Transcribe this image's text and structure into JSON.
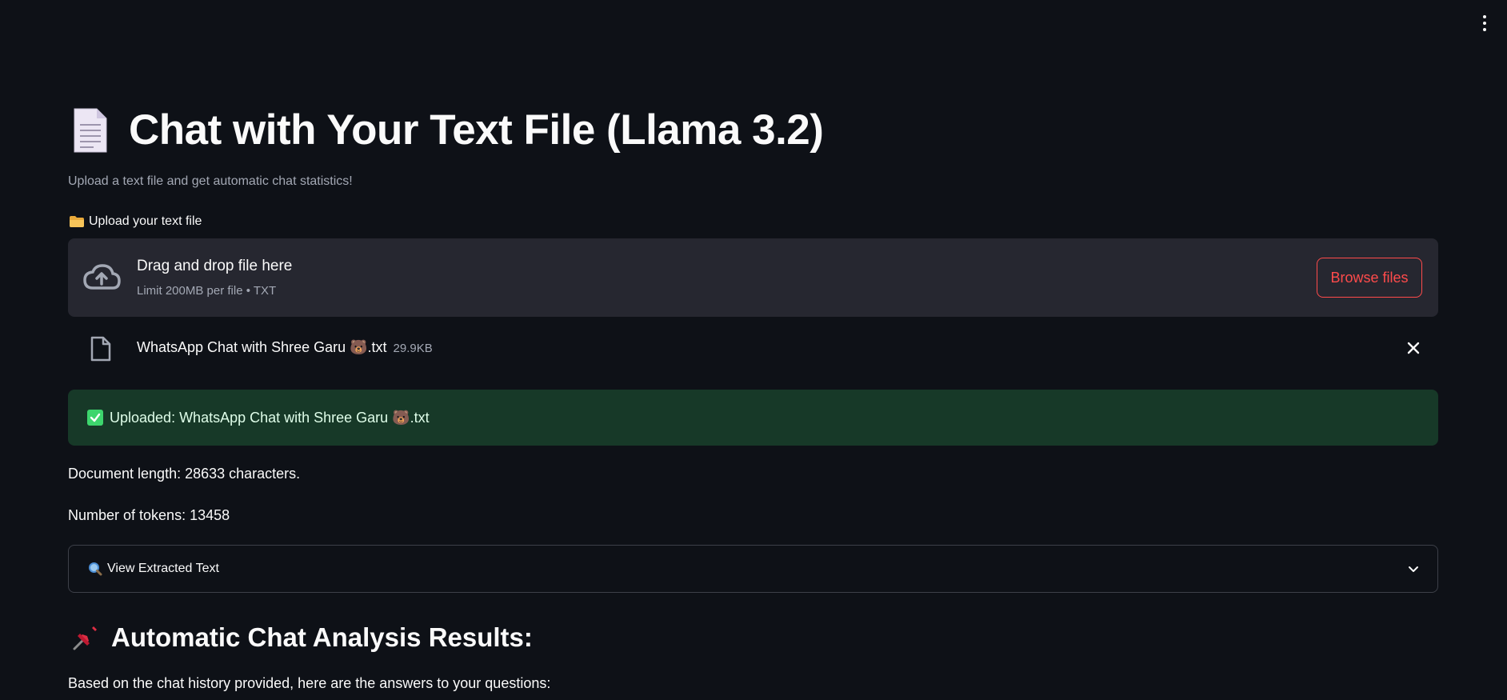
{
  "page": {
    "title": "Chat with Your Text File (Llama 3.2)",
    "subtitle": "Upload a text file and get automatic chat statistics!"
  },
  "uploader": {
    "label": "Upload your text file",
    "dropzone_title": "Drag and drop file here",
    "dropzone_limit": "Limit 200MB per file • TXT",
    "browse_label": "Browse files"
  },
  "uploaded_file": {
    "name": "WhatsApp Chat with Shree Garu 🐻.txt",
    "size": "29.9KB"
  },
  "status": {
    "success_message": "Uploaded: WhatsApp Chat with Shree Garu 🐻.txt"
  },
  "stats": {
    "document_length": "Document length: 28633 characters.",
    "token_count": "Number of tokens: 13458"
  },
  "expander": {
    "label": "View Extracted Text"
  },
  "results": {
    "heading": "Automatic Chat Analysis Results:",
    "intro": "Based on the chat history provided, here are the answers to your questions:"
  },
  "icons": {
    "title": "document-icon",
    "upload_label": "folder-icon",
    "dropzone": "cloud-upload-icon",
    "file": "file-icon",
    "remove": "close-icon",
    "success": "check-icon",
    "expander": "search-icon",
    "expander_toggle": "chevron-down-icon",
    "results": "pushpin-icon",
    "menu": "kebab-menu-icon"
  },
  "colors": {
    "background": "#0e1117",
    "dropzone_bg": "#262730",
    "accent": "#ff4b4b",
    "success_bg": "#173928",
    "success_text": "#dffde9",
    "muted_text": "#a3a8b4"
  }
}
